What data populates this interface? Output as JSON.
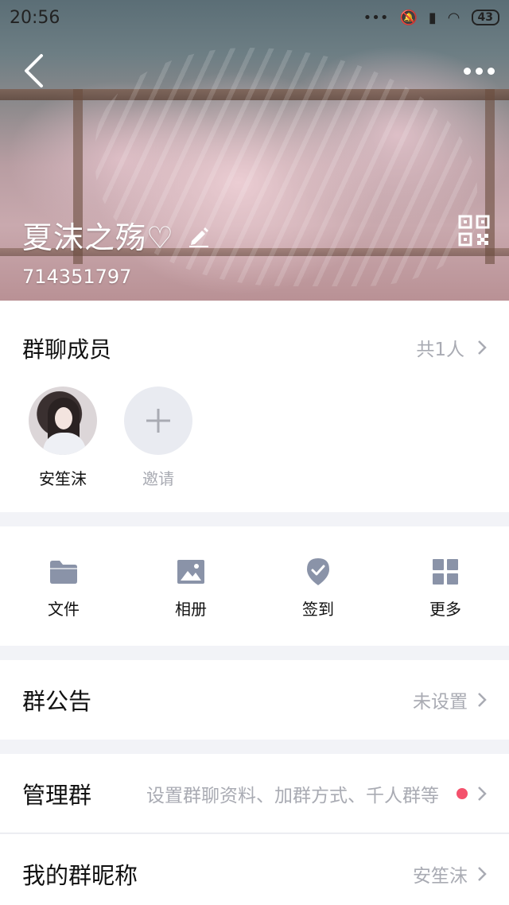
{
  "status_bar": {
    "time": "20:56",
    "battery": "43"
  },
  "header": {
    "group_name": "夏沫之殇♡",
    "group_id": "714351797"
  },
  "members": {
    "title": "群聊成员",
    "count": "共1人",
    "list": [
      {
        "name": "安笙沫"
      }
    ],
    "invite_label": "邀请"
  },
  "actions": [
    {
      "label": "文件",
      "icon": "folder-icon"
    },
    {
      "label": "相册",
      "icon": "image-icon"
    },
    {
      "label": "签到",
      "icon": "checkin-icon"
    },
    {
      "label": "更多",
      "icon": "grid-icon"
    }
  ],
  "rows": {
    "announcement": {
      "title": "群公告",
      "value": "未设置"
    },
    "manage": {
      "title": "管理群",
      "value": "设置群聊资料、加群方式、千人群等"
    },
    "nickname": {
      "title": "我的群昵称",
      "value": "安笙沫"
    }
  },
  "colors": {
    "accent_dot": "#f4516c",
    "muted_text": "#a9abb3",
    "icon_gray": "#8a93a8"
  }
}
